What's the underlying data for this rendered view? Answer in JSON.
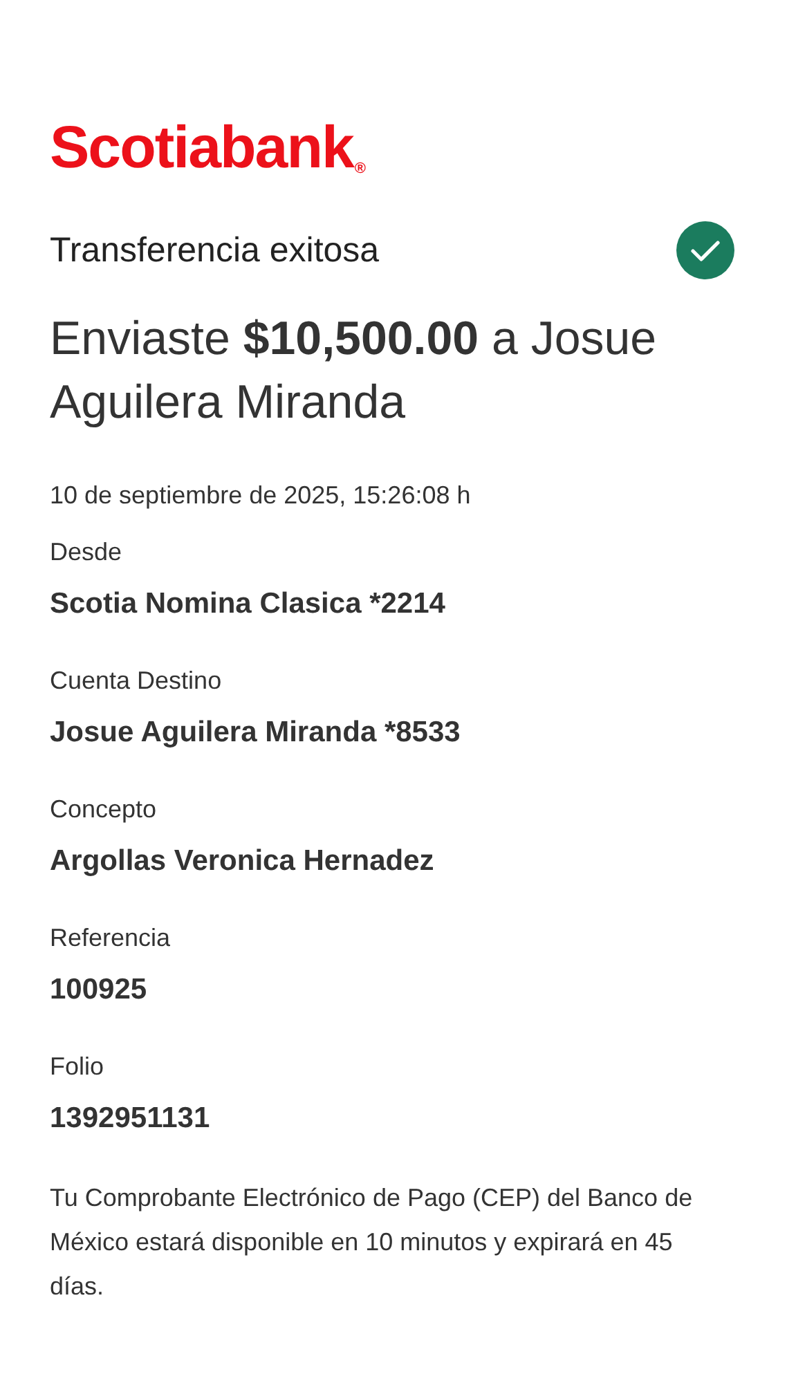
{
  "logo": {
    "name": "Scotiabank",
    "mark": "®"
  },
  "status": {
    "title": "Transferencia exitosa",
    "kind": "success"
  },
  "summary": "Enviaste **$10,500.00** a Josue Aguilera Miranda",
  "date": "10 de septiembre de 2025, 15:26:08 h",
  "details": [
    {
      "label": "Desde",
      "value": "Scotia Nomina Clasica *2214"
    },
    {
      "label": "Cuenta Destino",
      "value": "Josue Aguilera Miranda *8533"
    },
    {
      "label": "Concepto",
      "value": "Argollas Veronica Hernadez"
    },
    {
      "label": "Referencia",
      "value": "100925"
    },
    {
      "label": "Folio",
      "value": "1392951131"
    }
  ],
  "note": "Tu Comprobante Electrónico de Pago (CEP) del Banco de México estará disponible en 10 minutos y expirará en 45 días."
}
